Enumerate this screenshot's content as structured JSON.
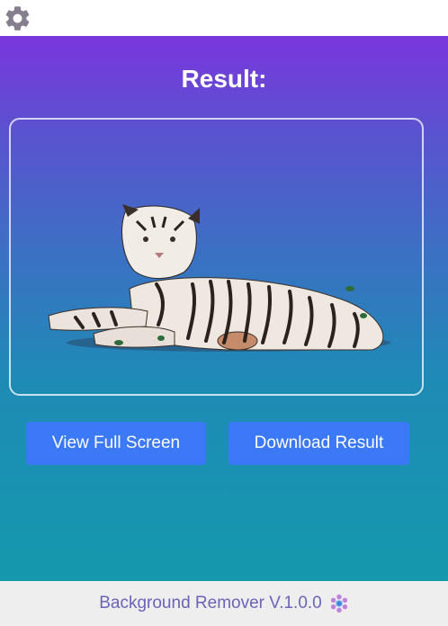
{
  "app": {
    "settings_icon": "gear-icon"
  },
  "result": {
    "title": "Result:",
    "image_subject": "tiger-image"
  },
  "buttons": {
    "view_full_screen": "View Full Screen",
    "download_result": "Download Result"
  },
  "footer": {
    "label": "Background Remover V.1.0.0",
    "icon": "molecule-icon"
  },
  "colors": {
    "gradient_top": "#7a36dd",
    "gradient_bottom": "#1499ad",
    "button_bg": "#3c79f8",
    "footer_text": "#6a63b9",
    "footer_bg": "#eeeeee"
  }
}
